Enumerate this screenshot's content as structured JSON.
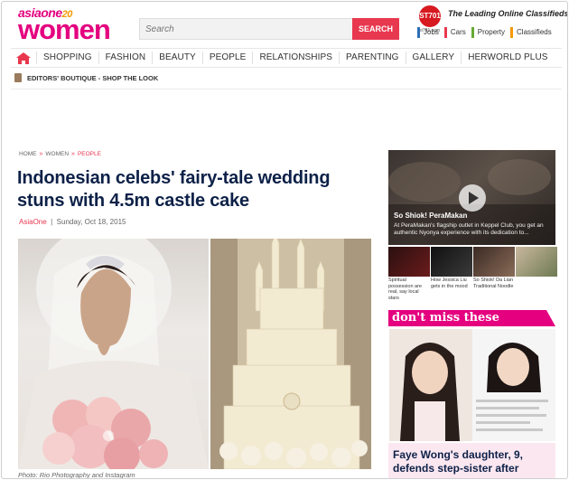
{
  "brand": {
    "top": "asiaone",
    "top_badge": "20",
    "bottom": "women"
  },
  "search": {
    "placeholder": "Search",
    "button": "SEARCH"
  },
  "classifieds": {
    "logo": "ST701",
    "url": "st701.com",
    "title": "The Leading Online Classifieds",
    "links": [
      "Jobs",
      "Cars",
      "Property",
      "Classifieds"
    ]
  },
  "nav": {
    "items": [
      "SHOPPING",
      "FASHION",
      "BEAUTY",
      "PEOPLE",
      "RELATIONSHIPS",
      "PARENTING",
      "GALLERY",
      "HERWORLD PLUS"
    ]
  },
  "subnav": {
    "label": "EDITORS' BOUTIQUE - SHOP THE LOOK"
  },
  "breadcrumb": [
    "HOME",
    "WOMEN",
    "PEOPLE"
  ],
  "article": {
    "title": "Indonesian celebs' fairy-tale wedding stuns with 4.5m castle cake",
    "source": "AsiaOne",
    "date": "Sunday, Oct 18, 2015",
    "caption": "Photo: Rio Photography and Instagram"
  },
  "video": {
    "title": "So Shiok! PeraMakan",
    "desc": "At PeraMakan's flagship outlet in Keppel Club, you get an authentic Nyonya experience with its dedication to..."
  },
  "thumbs": [
    {
      "caption": "Spiritual possession are real, say local stars"
    },
    {
      "caption": "How Jessica Liu gets in the mood"
    },
    {
      "caption": "So Shiok! Da Lian Traditional Noodle"
    },
    {
      "caption": ""
    }
  ],
  "dont_miss": {
    "label": "don't miss these",
    "headline": "Faye Wong's daughter, 9, defends step-sister after"
  },
  "colors": {
    "brand_pink": "#e4007f",
    "search_red": "#e8384f",
    "headline_navy": "#0d2148"
  }
}
